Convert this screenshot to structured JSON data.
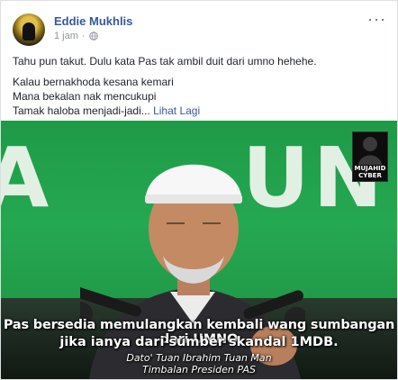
{
  "post": {
    "author": "Eddie Mukhlis",
    "timestamp": "1 jam",
    "separator": "·",
    "privacy_icon": "globe-icon",
    "more_icon": "more-options-icon",
    "lines": [
      "Tahu pun takut. Dulu kata Pas tak ambil duit dari umno hehehe.",
      "Kalau bernakhoda kesana kemari",
      "Mana bekalan nak mencukupi",
      "Tamak haloba menjadi-jadi..."
    ],
    "see_more": "Lihat Lagi"
  },
  "image": {
    "caption_line1": "Pas bersedia memulangkan kembali wang sumbangan dari UMNO",
    "caption_line2": "jika ianya dari sumber skandal 1MDB.",
    "attribution_name": "Dato' Tuan Ibrahim Tuan Man",
    "attribution_title": "Timbalan Presiden PAS",
    "watermark_line1": "MUJAHID",
    "watermark_line2": "CYBER",
    "background_letters_left": "A",
    "background_letters_right": "UN"
  },
  "colors": {
    "link": "#385898",
    "photo_green": "#22a04c"
  }
}
